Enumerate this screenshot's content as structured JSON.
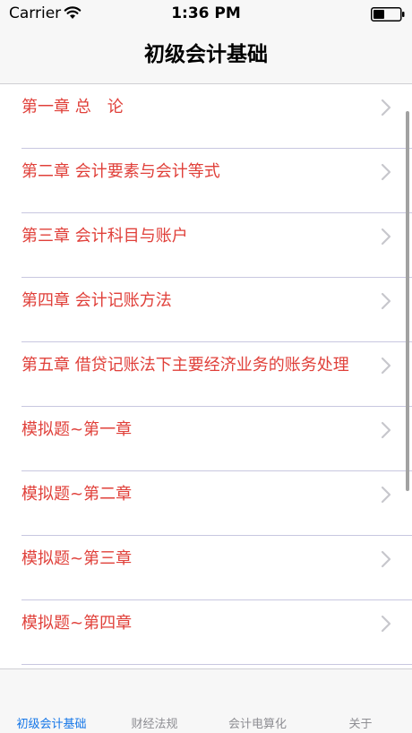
{
  "status_bar": {
    "carrier": "Carrier",
    "time": "1:36 PM"
  },
  "nav": {
    "title": "初级会计基础"
  },
  "list": {
    "items": [
      {
        "label": "第一章 总　论"
      },
      {
        "label": "第二章 会计要素与会计等式"
      },
      {
        "label": "第三章 会计科目与账户"
      },
      {
        "label": "第四章 会计记账方法"
      },
      {
        "label": "第五章 借贷记账法下主要经济业务的账务处理"
      },
      {
        "label": "模拟题~第一章"
      },
      {
        "label": "模拟题~第二章"
      },
      {
        "label": "模拟题~第三章"
      },
      {
        "label": "模拟题~第四章"
      }
    ]
  },
  "tab_bar": {
    "tabs": [
      {
        "label": "初级会计基础"
      },
      {
        "label": "财经法规"
      },
      {
        "label": "会计电算化"
      },
      {
        "label": "关于"
      }
    ],
    "active_color": "#1677e8",
    "inactive_color": "#8e8e93"
  },
  "colors": {
    "item_text": "#e0403a",
    "separator": "#c8c7e0",
    "bar_background": "#f7f7f7"
  }
}
